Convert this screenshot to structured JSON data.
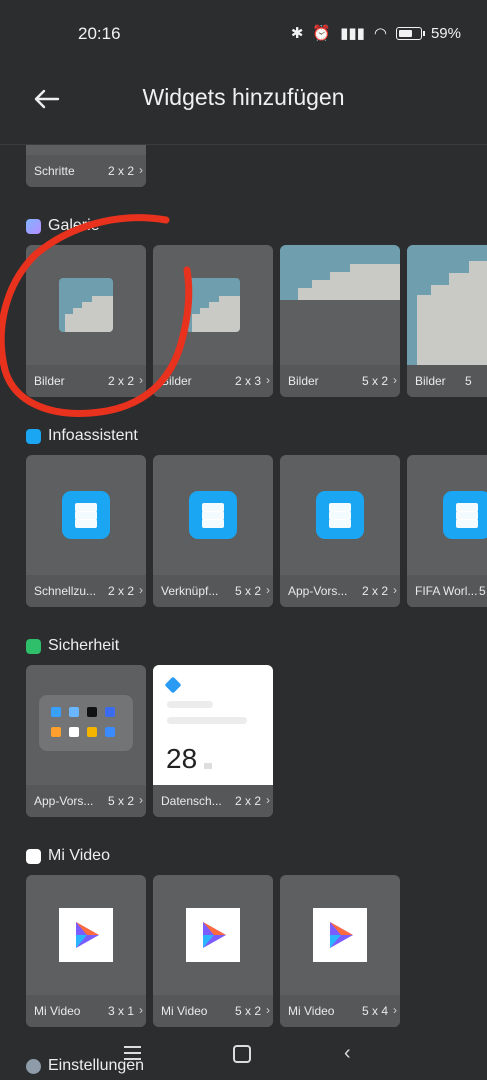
{
  "status": {
    "time": "20:16",
    "battery": "59%"
  },
  "header": {
    "title": "Widgets hinzufügen"
  },
  "sections": [
    {
      "label": "Galerie"
    },
    {
      "label": "Infoassistent"
    },
    {
      "label": "Sicherheit"
    },
    {
      "label": "Mi Video"
    },
    {
      "label": "Einstellungen"
    }
  ],
  "widgets": {
    "top": [
      {
        "name": "Schritte",
        "size": "2 x 2"
      }
    ],
    "galerie": [
      {
        "name": "Bilder",
        "size": "2 x 2"
      },
      {
        "name": "Bilder",
        "size": "2 x 3"
      },
      {
        "name": "Bilder",
        "size": "5 x 2"
      },
      {
        "name": "Bilder",
        "size": "5"
      }
    ],
    "info": [
      {
        "name": "Schnellzu...",
        "size": "2 x 2"
      },
      {
        "name": "Verknüpf...",
        "size": "5 x 2"
      },
      {
        "name": "App-Vors...",
        "size": "2 x 2"
      },
      {
        "name": "FIFA Worl...",
        "size": "5"
      }
    ],
    "sicherheit": [
      {
        "name": "App-Vors...",
        "size": "5 x 2"
      },
      {
        "name": "Datensch...",
        "size": "2 x 2",
        "value": "28"
      }
    ],
    "mivideo": [
      {
        "name": "Mi Video",
        "size": "3 x 1"
      },
      {
        "name": "Mi Video",
        "size": "5 x 2"
      },
      {
        "name": "Mi Video",
        "size": "5 x 4"
      }
    ]
  },
  "colors": {
    "background": "#2b2d2e",
    "card": "#5d5f60",
    "accent_annotation": "#e8321e"
  }
}
